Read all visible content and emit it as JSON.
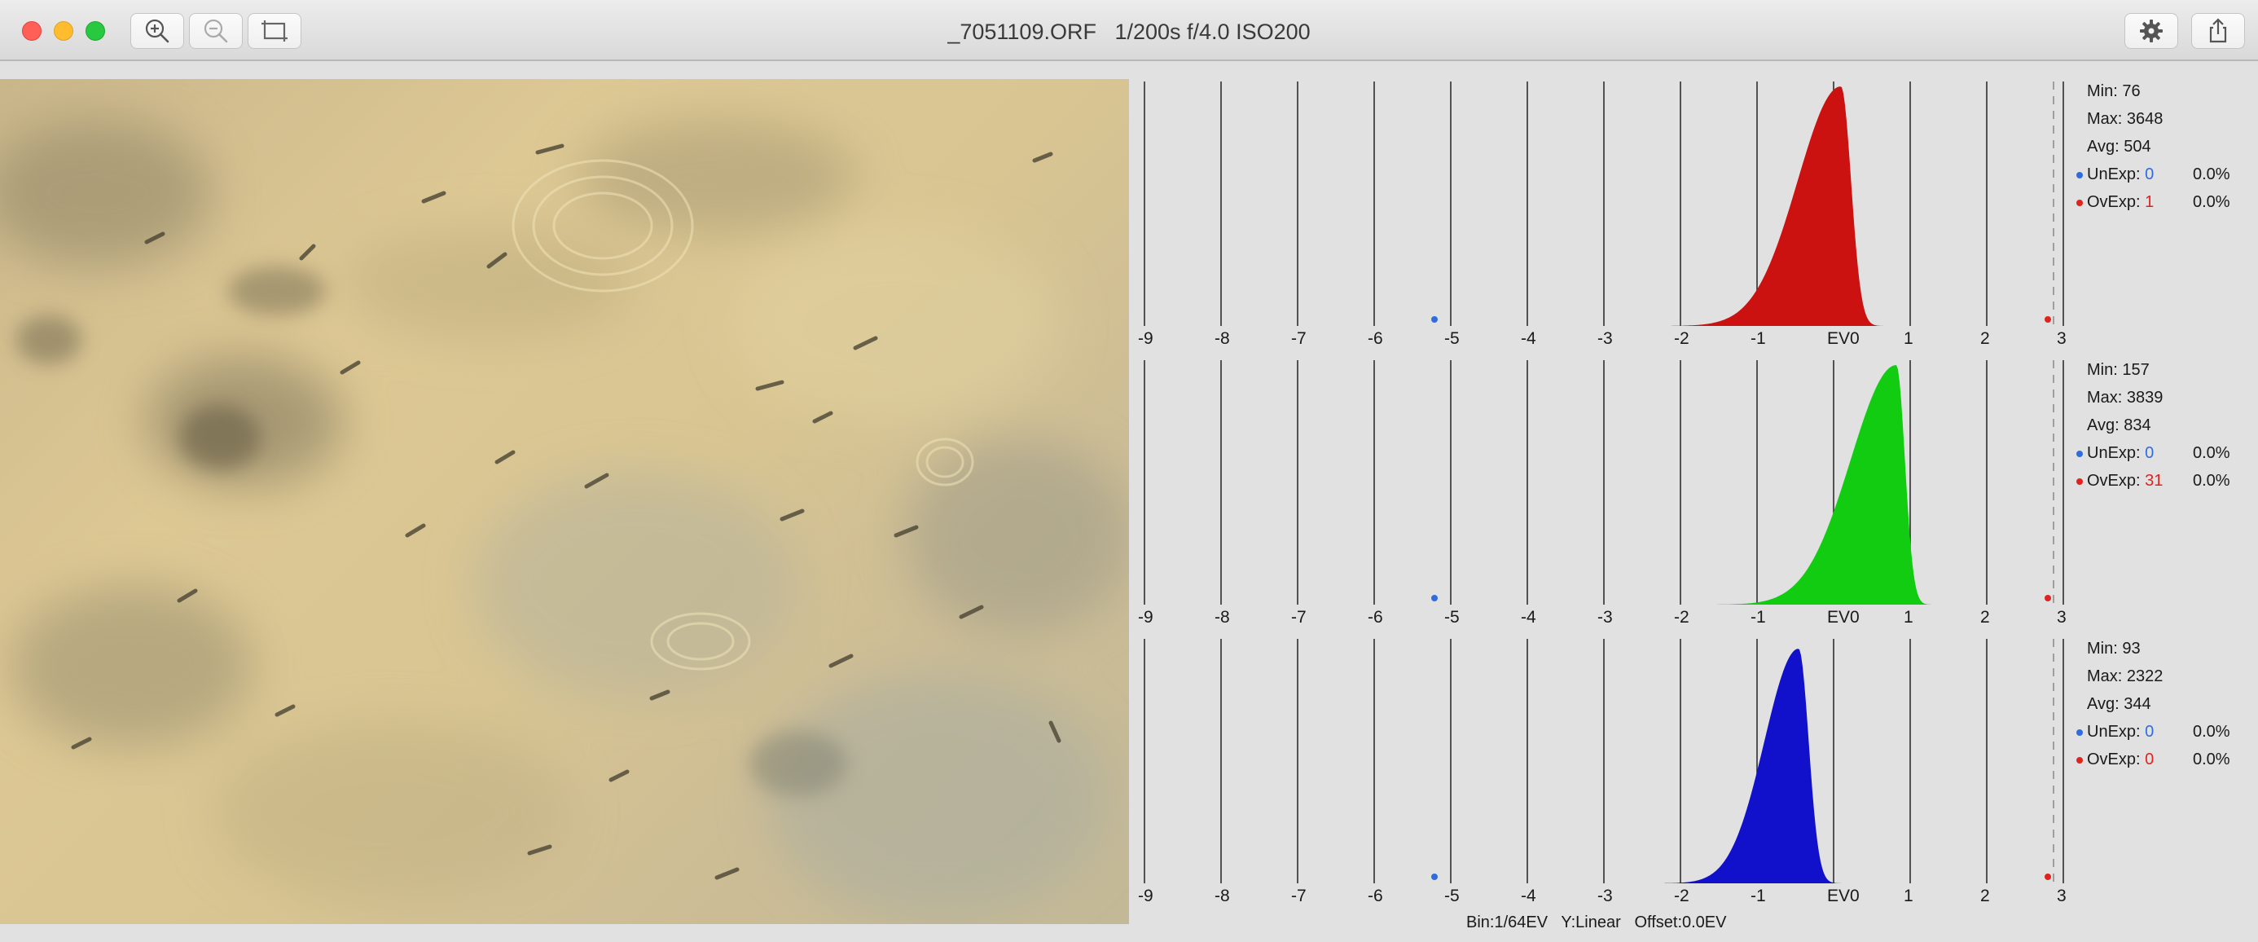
{
  "window": {
    "title": "_7051109.ORF   1/200s f/4.0 ISO200",
    "toolbar": {
      "left_buttons": [
        "zoom-in-icon",
        "zoom-out-icon",
        "crop-icon"
      ],
      "right_buttons": [
        "gear-icon",
        "share-icon"
      ]
    }
  },
  "histogram": {
    "ev_ticks": [
      "-9",
      "-8",
      "-7",
      "-6",
      "-5",
      "-4",
      "-3",
      "-2",
      "-1",
      "EV0",
      "1",
      "2",
      "3"
    ],
    "footer": {
      "bin": "Bin:1/64EV",
      "yscale": "Y:Linear",
      "offset": "Offset:0.0EV"
    },
    "channels": [
      {
        "name": "red",
        "color": "#cc1111",
        "min": "Min: 76",
        "max": "Max: 3648",
        "avg": "Avg: 504",
        "unexp_label": "UnExp:",
        "unexp_value": "0",
        "unexp_pct": "0.0%",
        "ovexp_label": "OvExp:",
        "ovexp_value": "1",
        "ovexp_pct": "0.0%"
      },
      {
        "name": "green",
        "color": "#11cc11",
        "min": "Min: 157",
        "max": "Max: 3839",
        "avg": "Avg: 834",
        "unexp_label": "UnExp:",
        "unexp_value": "0",
        "unexp_pct": "0.0%",
        "ovexp_label": "OvExp:",
        "ovexp_value": "31",
        "ovexp_pct": "0.0%"
      },
      {
        "name": "blue",
        "color": "#1111cc",
        "min": "Min: 93",
        "max": "Max: 2322",
        "avg": "Avg: 344",
        "unexp_label": "UnExp:",
        "unexp_value": "0",
        "unexp_pct": "0.0%",
        "ovexp_label": "OvExp:",
        "ovexp_value": "0",
        "ovexp_pct": "0.0%"
      }
    ]
  }
}
